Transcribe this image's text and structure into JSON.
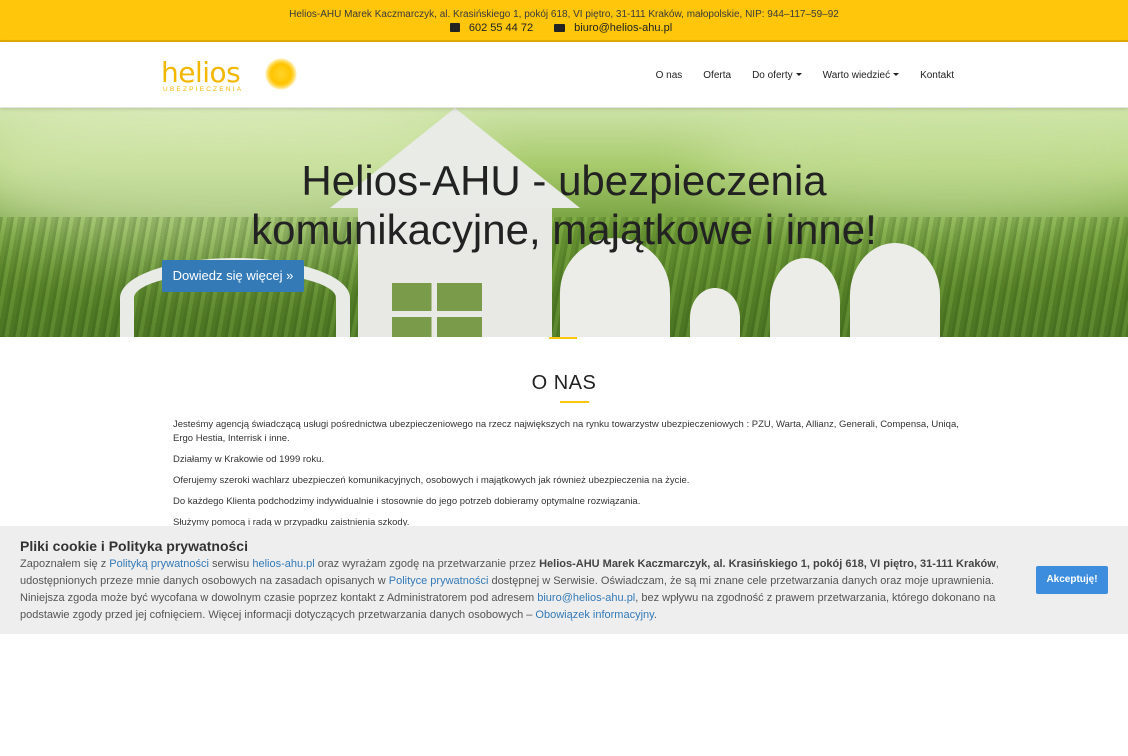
{
  "topbar": {
    "company_line": "Helios-AHU Marek Kaczmarczyk, al. Krasińskiego 1, pokój 618, VI piętro, 31-111 Kraków, małopolskie, NIP: 944–117–59–92",
    "phone": "602 55 44 72",
    "email": "biuro@helios-ahu.pl"
  },
  "logo": {
    "name": "helios",
    "tagline": "UBEZPIECZENIA"
  },
  "nav": {
    "items": [
      {
        "label": "O nas"
      },
      {
        "label": "Oferta"
      },
      {
        "label": "Do oferty"
      },
      {
        "label": "Warto wiedzieć"
      },
      {
        "label": "Kontakt"
      }
    ]
  },
  "hero": {
    "title_line1": "Helios-AHU - ubezpieczenia",
    "title_line2": "komunikacyjne, majątkowe i inne!",
    "button": "Dowiedz się więcej »"
  },
  "about": {
    "title": "O NAS",
    "paragraphs": [
      "Jesteśmy agencją świadczącą usługi pośrednictwa ubezpieczeniowego na rzecz największych na rynku towarzystw ubezpieczeniowych : PZU, Warta, Allianz, Generali, Compensa, Uniqa, Ergo Hestia, Interrisk i inne.",
      "Działamy w Krakowie od 1999 roku.",
      "Oferujemy szeroki wachlarz ubezpieczeń komunikacyjnych, osobowych i majątkowych jak również ubezpieczenia na życie.",
      "Do każdego Klienta podchodzimy indywidualnie i stosownie do jego potrzeb dobieramy optymalne rozwiązania.",
      "Służymy pomocą i radą w przypadku zaistnienia szkody."
    ]
  },
  "cookie": {
    "title": "Pliki cookie i Polityka prywatności",
    "t1": "Zapoznałem się z ",
    "l1": "Polityką prywatności",
    "t2": " serwisu ",
    "l2": "helios-ahu.pl",
    "t3": " oraz wyrażam zgodę na przetwarzanie przez ",
    "b1": "Helios-AHU Marek Kaczmarczyk, al. Krasińskiego 1, pokój 618, VI piętro, 31-111 Kraków",
    "t4": ", udostępnionych przeze mnie danych osobowych na zasadach opisanych w ",
    "l3": "Polityce prywatności",
    "t5": " dostępnej w Serwisie. Oświadczam, że są mi znane cele przetwarzania danych oraz moje uprawnienia. Niniejsza zgoda może być wycofana w dowolnym czasie poprzez kontakt z Administratorem pod adresem ",
    "l4": "biuro@helios-ahu.pl",
    "t6": ", bez wpływu na zgodność z prawem przetwarzania, którego dokonano na podstawie zgody przed jej cofnięciem. Więcej informacji dotyczących przetwarzania danych osobowych – ",
    "l5": "Obowiązek informacyjny",
    "t7": ".",
    "accept": "Akceptuję!"
  }
}
